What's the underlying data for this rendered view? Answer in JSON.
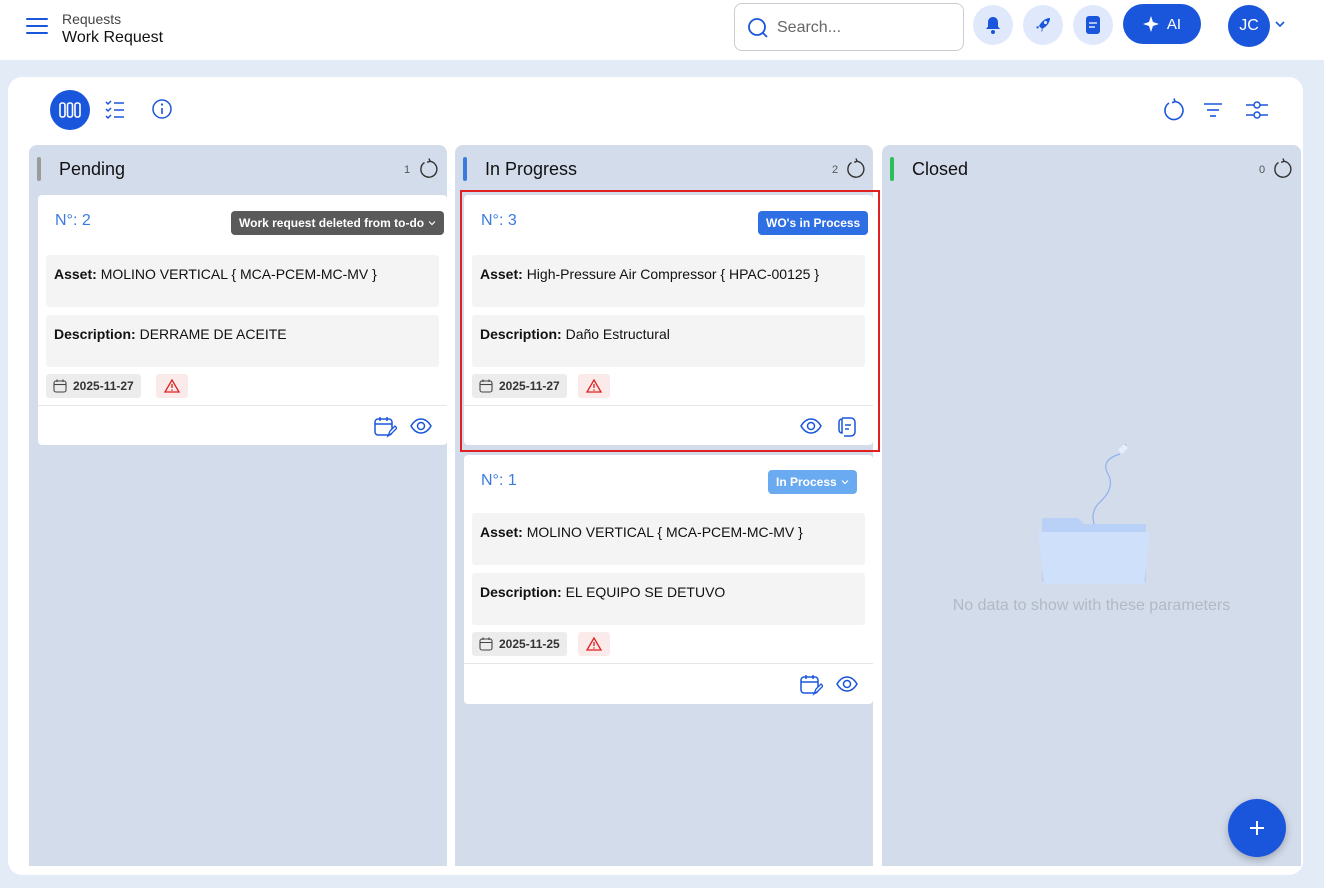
{
  "header": {
    "breadcrumb_parent": "Requests",
    "page_title": "Work Request",
    "search_placeholder": "Search...",
    "ai_label": "AI",
    "avatar_initials": "JC"
  },
  "toolbar": {
    "views": [
      "board-view",
      "list-view",
      "info"
    ],
    "actions": [
      "refresh",
      "filter",
      "adjust"
    ]
  },
  "columns": [
    {
      "title": "Pending",
      "count": "1",
      "bar_color": "#9a9a9a",
      "cards": [
        {
          "number": "N°: 2",
          "badge": "Work request deleted from to-do",
          "badge_color": "#5a5a5a",
          "asset_label": "Asset:",
          "asset": "MOLINO VERTICAL { MCA-PCEM-MC-MV }",
          "description_label": "Description:",
          "description": "DERRAME DE ACEITE",
          "date": "2025-11-27"
        }
      ]
    },
    {
      "title": "In Progress",
      "count": "2",
      "bar_color": "#3b7be0",
      "cards": [
        {
          "number": "N°: 3",
          "badge": "WO's in Process",
          "badge_color": "#2f6fe4",
          "asset_label": "Asset:",
          "asset": "High-Pressure Air Compressor { HPAC-00125 }",
          "description_label": "Description:",
          "description": "Daño Estructural",
          "date": "2025-11-27"
        },
        {
          "number": "N°: 1",
          "badge": "In Process",
          "badge_color": "#6aaaf0",
          "asset_label": "Asset:",
          "asset": "MOLINO VERTICAL { MCA-PCEM-MC-MV }",
          "description_label": "Description:",
          "description": "EL EQUIPO SE DETUVO",
          "date": "2025-11-25"
        }
      ]
    },
    {
      "title": "Closed",
      "count": "0",
      "bar_color": "#2dbd5a",
      "cards": [],
      "empty_text": "No data to show with these parameters"
    }
  ],
  "colors": {
    "accent": "#1a56db",
    "highlight": "#e02020",
    "warning": "#e02020"
  }
}
